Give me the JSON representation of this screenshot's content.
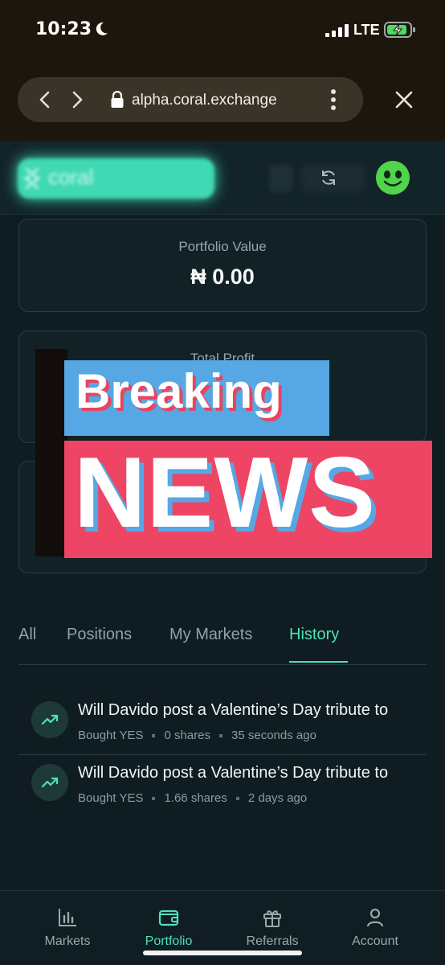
{
  "status_bar": {
    "time": "10:23",
    "network": "LTE",
    "icons": [
      "moon-icon",
      "signal-icon",
      "battery-charging-icon"
    ]
  },
  "browser": {
    "url": "alpha.coral.exchange",
    "icons": [
      "back-arrow-icon",
      "forward-arrow-icon",
      "lock-icon",
      "more-vertical-icon",
      "close-icon"
    ]
  },
  "header": {
    "logo_text": "coral",
    "icons": [
      "coral-logo-icon",
      "refresh-icon",
      "avatar-smiley-icon"
    ]
  },
  "cards": {
    "portfolio": {
      "label": "Portfolio Value",
      "value": "₦ 0.00"
    },
    "profit": {
      "label": "Total Profit"
    }
  },
  "overlay": {
    "line1": "Breaking",
    "line2": "NEWS"
  },
  "tabs": {
    "all": "All",
    "positions": "Positions",
    "my_markets": "My Markets",
    "history": "History",
    "active": "History"
  },
  "history": [
    {
      "title": "Will Davido post a Valentine’s Day tribute to",
      "action": "Bought YES",
      "shares": "0 shares",
      "time": "35 seconds ago",
      "icon": "trending-up-icon"
    },
    {
      "title": "Will Davido post a Valentine’s Day tribute to",
      "action": "Bought YES",
      "shares": "1.66 shares",
      "time": "2 days ago",
      "icon": "trending-up-icon"
    }
  ],
  "bottom_nav": {
    "markets": "Markets",
    "portfolio": "Portfolio",
    "referrals": "Referrals",
    "account": "Account",
    "active": "Portfolio"
  },
  "colors": {
    "accent": "#4fe1ba",
    "background": "#0f1c21",
    "breaking_blue": "#56a7e3",
    "news_red": "#ee4564"
  }
}
